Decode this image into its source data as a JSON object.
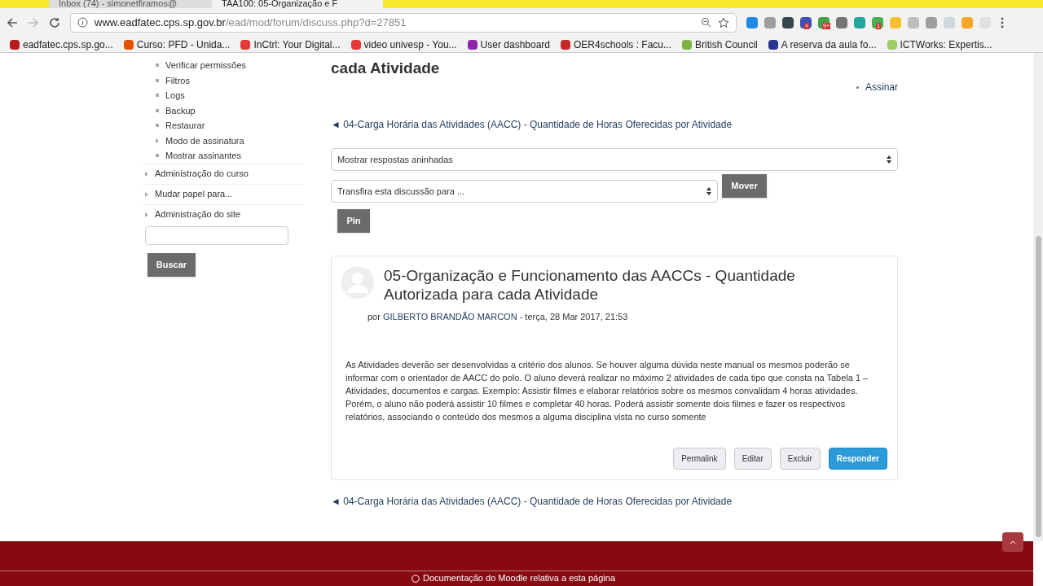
{
  "browser": {
    "tabs": [
      {
        "title": "Inbox (74) - simonetfiramos@",
        "selected": false
      },
      {
        "title": "TAA100: 05-Organização e F",
        "selected": true
      }
    ],
    "url_host": "www.eadfatec.cps.sp.gov.br",
    "url_path": "/ead/mod/forum/discuss.php?d=27851",
    "extensions": [
      {
        "color": "#1e88e5"
      },
      {
        "color": "#9e9e9e"
      },
      {
        "color": "#37474f"
      },
      {
        "color": "#3f51b5",
        "badge": "×"
      },
      {
        "color": "#43a047",
        "badge": "9+"
      },
      {
        "color": "#757575"
      },
      {
        "color": "#26a69a"
      },
      {
        "color": "#4caf50",
        "badge": "1"
      },
      {
        "color": "#fbc02d"
      },
      {
        "color": "#bdbdbd"
      },
      {
        "color": "#9e9e9e"
      },
      {
        "color": "#cfd8dc"
      },
      {
        "color": "#f9a825"
      },
      {
        "color": "#e0e0e0"
      }
    ],
    "bookmarks": [
      {
        "label": "eadfatec.cps.sp.go...",
        "color": "#b71c1c"
      },
      {
        "label": "Curso: PFD - Unida...",
        "color": "#e65100"
      },
      {
        "label": "InCtrl: Your Digital...",
        "color": "#e53935"
      },
      {
        "label": "video univesp - You...",
        "color": "#e53935"
      },
      {
        "label": "User dashboard",
        "color": "#8e24aa"
      },
      {
        "label": "OER4schools : Facu...",
        "color": "#c62828"
      },
      {
        "label": "British Council",
        "color": "#7cb342"
      },
      {
        "label": "A reserva da aula fo...",
        "color": "#283593"
      },
      {
        "label": "ICTWorks: Expertis...",
        "color": "#9ccc65"
      }
    ]
  },
  "sidebar": {
    "items": [
      {
        "label": "Verificar permissões",
        "kind": "leaf"
      },
      {
        "label": "Filtros",
        "kind": "leaf"
      },
      {
        "label": "Logs",
        "kind": "leaf"
      },
      {
        "label": "Backup",
        "kind": "leaf"
      },
      {
        "label": "Restaurar",
        "kind": "leaf"
      },
      {
        "label": "Modo de assinatura",
        "kind": "branch"
      },
      {
        "label": "Mostrar assinantes",
        "kind": "leaf"
      }
    ],
    "nodes": [
      {
        "label": "Administração do curso",
        "expanded": false
      },
      {
        "label": "Mudar papel para...",
        "expanded": false
      },
      {
        "label": "Administração do site",
        "expanded": false
      }
    ],
    "search_button": "Buscar"
  },
  "main": {
    "heading": "cada Atividade",
    "subscribe": "Assinar",
    "prev_link": "◄ 04-Carga Horária das Atividades (AACC) - Quantidade de Horas Oferecidas por Atividade",
    "display_select": "Mostrar respostas aninhadas",
    "move_select": "Transfira esta discussão para ...",
    "move_button": "Mover",
    "pin_button": "Pin",
    "post": {
      "title": "05-Organização e Funcionamento das AACCs - Quantidade Autorizada para cada Atividade",
      "by": "por",
      "author": "GILBERTO BRANDÃO MARCON",
      "date": "- terça, 28 Mar 2017, 21:53",
      "body": "As Atividades deverão ser desenvolvidas a critério dos alunos. Se houver alguma dúvida neste manual os mesmos poderão se informar com o orientador de AACC do polo. O aluno deverá realizar no máximo 2 atividades de cada tipo que consta na Tabela 1 – Atividades, documentos e cargas. Exemplo: Assistir filmes e elaborar relatórios sobre os mesmos convalidam 4 horas atividades. Porém, o aluno não poderá assistir 10 filmes e completar 40 horas. Poderá assistir somente dois filmes e fazer os respectivos relatórios, associando o conteúdo dos mesmos a alguma disciplina vista no curso somente",
      "actions": [
        {
          "label": "Permalink",
          "kind": "default"
        },
        {
          "label": "Editar",
          "kind": "default"
        },
        {
          "label": "Excluir",
          "kind": "default"
        },
        {
          "label": "Responder",
          "kind": "primary"
        }
      ]
    },
    "next_link": "◄ 04-Carga Horária das Atividades (AACC) - Quantidade de Horas Oferecidas por Atividade"
  },
  "footer": {
    "doc_link": "Documentação do Moodle relativa a esta página"
  }
}
